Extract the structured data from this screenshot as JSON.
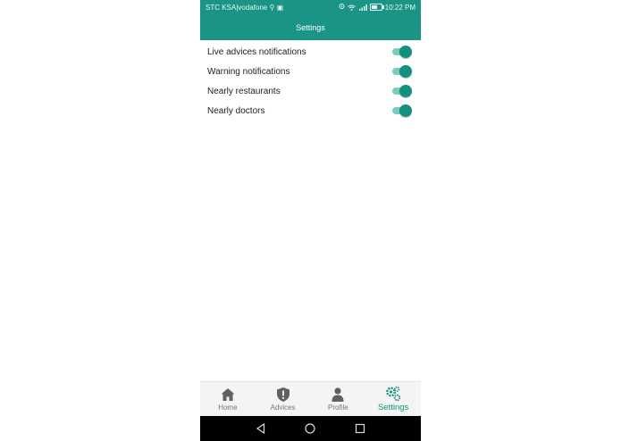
{
  "status_bar": {
    "carrier": "STC KSA|vodafone",
    "time": "10:22 PM",
    "battery_level": 0.6
  },
  "header": {
    "title": "Settings"
  },
  "settings": [
    {
      "label": "Live advices notifications",
      "enabled": true
    },
    {
      "label": "Warning notifications",
      "enabled": true
    },
    {
      "label": "Nearly restaurants",
      "enabled": true
    },
    {
      "label": "Nearly doctors",
      "enabled": true
    }
  ],
  "bottom_nav": {
    "items": [
      {
        "label": "Home",
        "icon": "home-icon",
        "active": false
      },
      {
        "label": "Advices",
        "icon": "shield-alert-icon",
        "active": false
      },
      {
        "label": "Profile",
        "icon": "person-icon",
        "active": false
      },
      {
        "label": "Settings",
        "icon": "gears-icon",
        "active": true
      }
    ]
  },
  "colors": {
    "primary": "#1a9484",
    "switch_thumb": "#14907e",
    "switch_track": "#7fcabe",
    "inactive_nav": "#757575"
  }
}
